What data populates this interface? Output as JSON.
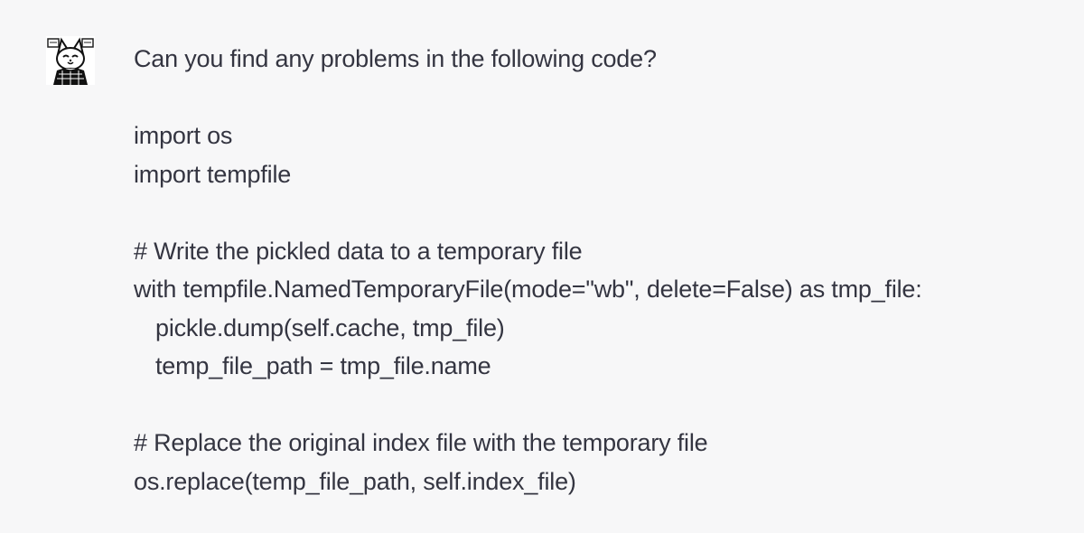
{
  "message": {
    "role": "user",
    "avatar_icon": "user-avatar-cat-icon",
    "lines": [
      "Can you find any problems in the following code?",
      "",
      "import os",
      "import tempfile",
      "",
      "# Write the pickled data to a temporary file",
      "with tempfile.NamedTemporaryFile(mode=\"wb\", delete=False) as tmp_file:",
      "pickle.dump(self.cache, tmp_file)",
      "temp_file_path = tmp_file.name",
      "",
      "# Replace the original index file with the temporary file",
      "os.replace(temp_file_path, self.index_file)"
    ]
  },
  "colors": {
    "background": "#f7f7f8",
    "text": "#343541"
  }
}
